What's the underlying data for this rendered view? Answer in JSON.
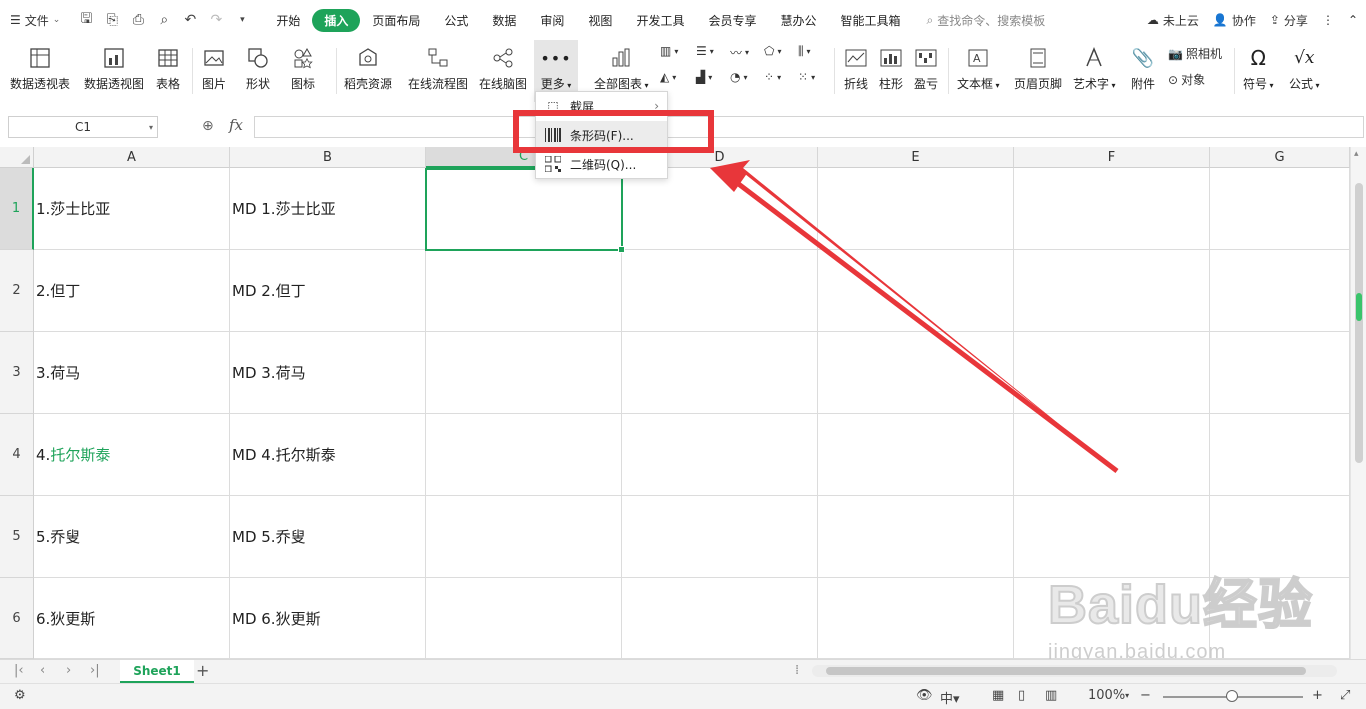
{
  "menubar": {
    "file_label": "文件",
    "tabs": [
      "开始",
      "插入",
      "页面布局",
      "公式",
      "数据",
      "审阅",
      "视图",
      "开发工具",
      "会员专享",
      "慧办公",
      "智能工具箱"
    ],
    "active_tab": "插入",
    "search_placeholder": "查找命令、搜索模板",
    "cloud_label": "未上云",
    "collab_label": "协作",
    "share_label": "分享"
  },
  "ribbon": {
    "pivot_table": "数据透视表",
    "pivot_chart": "数据透视图",
    "table": "表格",
    "picture": "图片",
    "shape": "形状",
    "icon": "图标",
    "docer": "稻壳资源",
    "flowchart": "在线流程图",
    "mindmap": "在线脑图",
    "more": "更多",
    "all_charts": "全部图表",
    "line": "折线",
    "column": "柱形",
    "winloss": "盈亏",
    "textbox": "文本框",
    "header_footer": "页眉页脚",
    "wordart": "艺术字",
    "attachment": "附件",
    "camera": "照相机",
    "object": "对象",
    "symbol": "符号",
    "formula": "公式"
  },
  "dropdown": {
    "items": [
      "截屏",
      "条形码(F)...",
      "二维码(Q)..."
    ]
  },
  "formula_bar": {
    "cell_ref": "C1",
    "fx": "fx",
    "content": ""
  },
  "grid": {
    "columns": [
      "A",
      "B",
      "C",
      "D",
      "E",
      "F",
      "G"
    ],
    "rows": [
      "1",
      "2",
      "3",
      "4",
      "5",
      "6"
    ],
    "cells_a": [
      "1.莎士比亚",
      "2.但丁",
      "3.荷马",
      "4.托尔斯泰",
      "5.乔叟",
      "6.狄更斯"
    ],
    "cells_b": [
      "MD 1.莎士比亚",
      "MD 2.但丁",
      "MD 3.荷马",
      "MD 4.托尔斯泰",
      "MD 5.乔叟",
      "MD 6.狄更斯"
    ],
    "highlight_color": "#1ea35a"
  },
  "sheets": {
    "tabs": [
      "Sheet1"
    ],
    "add": "+"
  },
  "statusbar": {
    "zoom": "100%",
    "minus": "−",
    "plus": "+"
  },
  "watermark": {
    "brand": "Baidu经验",
    "url": "jingyan.baidu.com"
  },
  "colors": {
    "accent": "#1ea35a",
    "annotation": "#e8363a"
  }
}
